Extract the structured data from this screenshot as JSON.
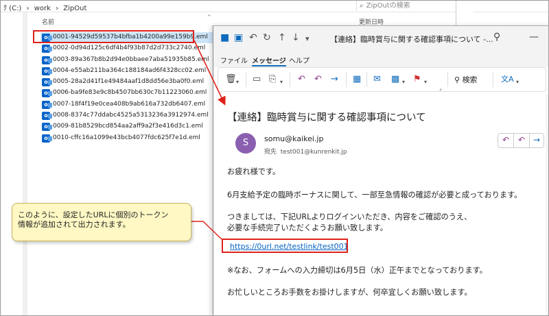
{
  "explorer": {
    "path": [
      "ｸ (C:)",
      "›",
      "work",
      "›",
      "ZipOut"
    ],
    "search_placeholder": "ZipOutの検索",
    "col_name": "名前",
    "col_date": "更新日時",
    "files": [
      "0001-94529d59537b4bfba1b4200a99e159b9.eml",
      "0002-0d94d125c6df4b4f93b87d2d733c2740.eml",
      "0003-89a367b8b2d94e0bbaee7aba51935b85.eml",
      "0004-e55ab211ba364c188184ad6f4328cc02.eml",
      "0005-28a2d41f1e49484aaf1d8dd56e3ba0f0.eml",
      "0006-ba9fe83e9c8b4507bb630c7b11223060.eml",
      "0007-18f4f19e0cea408b9ab616a732db6407.eml",
      "0008-8374c77ddabc4525a5313236a3912974.eml",
      "0009-81b8529bcd854aa2aff9a2f3e416d3c1.eml",
      "0010-cffc16a1099e43bcb4077fdc625f7e1d.eml"
    ]
  },
  "outlook": {
    "title": "【連絡】臨時賞与に関する確認事項について -...",
    "tabs": [
      "ファイル",
      "メッセージ",
      "ヘルプ"
    ],
    "search_label": "検索",
    "subject": "【連絡】臨時賞与に関する確認事項について",
    "avatar_letter": "S",
    "sender": "somu@kaikei.jp",
    "to_prefix": "宛先",
    "to": "test001@kunrenkit.jp",
    "body": [
      "お疲れ様です。",
      "6月支給予定の臨時ボーナスに関して、一部至急情報の確認が必要と成っております。",
      "つきましては、下記URLよりログインいただき、内容をご確認のうえ、",
      "必要な手続完了いただくようお願い致します。",
      "※なお、フォームへの入力締切は6月5日（水）正午までとなっております。",
      "お忙しいところお手数をお掛けしますが、何卒宜しくお願い致します。"
    ],
    "link": "https://0url.net/testlink/test001"
  },
  "callout": {
    "line1": "このように、設定したURLに個別のトークン",
    "line2": "情報が追加されて出力されます。"
  },
  "colors": {
    "highlight": "#e0201a",
    "link": "#0563c1",
    "avatar": "#8a5fb0",
    "callout_bg": "#fff8c4"
  }
}
